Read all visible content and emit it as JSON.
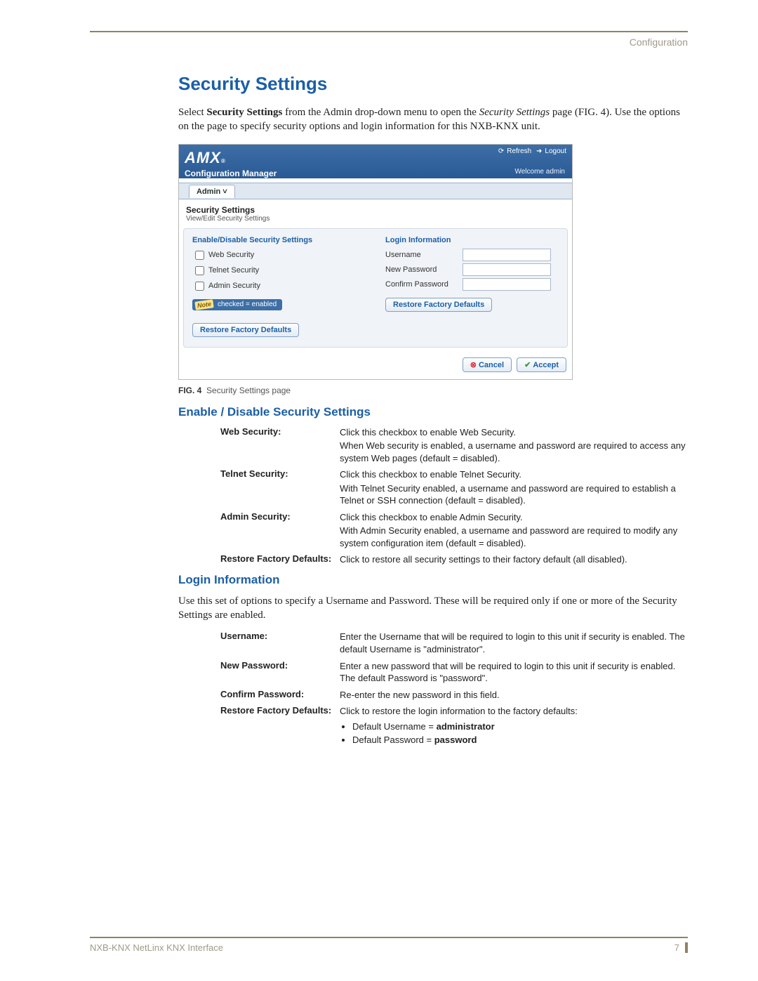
{
  "header": {
    "section_label": "Configuration"
  },
  "title": "Security Settings",
  "intro": {
    "pre": "Select ",
    "bold": "Security Settings",
    "mid": " from the Admin drop-down menu to open the ",
    "ital": "Security Settings",
    "post": " page (FIG. 4). Use the options on the page to specify security options and login information for this NXB-KNX unit."
  },
  "app": {
    "brand": "AMX",
    "subbrand": "Configuration Manager",
    "refresh": "Refresh",
    "logout": "Logout",
    "welcome": "Welcome admin",
    "tab_admin": "Admin ˅",
    "section_title": "Security Settings",
    "section_sub": "View/Edit Security Settings",
    "left_heading": "Enable/Disable Security Settings",
    "cb_web": "Web Security",
    "cb_telnet": "Telnet Security",
    "cb_admin": "Admin Security",
    "note_tag": "Note",
    "note_text": "checked = enabled",
    "btn_restore": "Restore Factory Defaults",
    "right_heading": "Login Information",
    "lbl_username": "Username",
    "lbl_newpw": "New Password",
    "lbl_confpw": "Confirm Password",
    "btn_restore2": "Restore Factory Defaults",
    "btn_cancel": "Cancel",
    "btn_accept": "Accept"
  },
  "fig_caption": {
    "num": "FIG. 4",
    "text": "Security Settings page"
  },
  "subhead1": "Enable / Disable Security Settings",
  "table1": [
    {
      "label": "Web Security:",
      "l1": "Click this checkbox to enable Web Security.",
      "l2": "When Web security is enabled, a username and password are required to access any system Web pages (default = disabled)."
    },
    {
      "label": "Telnet Security:",
      "l1": "Click this checkbox to enable Telnet Security.",
      "l2": "With Telnet Security enabled, a username and password are required to establish a Telnet or SSH connection (default = disabled)."
    },
    {
      "label": "Admin Security:",
      "l1": "Click this checkbox to enable Admin Security.",
      "l2": "With Admin Security enabled, a username and password are required to modify any system configuration item (default = disabled)."
    },
    {
      "label": "Restore Factory Defaults:",
      "l1": "Click to restore all security settings to their factory default (all disabled)."
    }
  ],
  "subhead2": "Login Information",
  "login_intro": "Use this set of options to specify a Username and Password. These will be required only if one or more of the Security Settings are enabled.",
  "table2": {
    "username": {
      "label": "Username:",
      "text": "Enter the Username that will be required to login to this unit if security is enabled. The default Username is \"administrator\"."
    },
    "newpw": {
      "label": "New Password:",
      "text": "Enter a new password that will be required to login to this unit if security is enabled. The default Password is \"password\"."
    },
    "confpw": {
      "label": "Confirm Password:",
      "text": "Re-enter the new password in this field."
    },
    "restore": {
      "label": "Restore Factory Defaults:",
      "text": "Click to restore the login information to the factory defaults:",
      "b1_pre": "Default Username = ",
      "b1_bold": "administrator",
      "b2_pre": "Default Password = ",
      "b2_bold": "password"
    }
  },
  "footer": {
    "doc": "NXB-KNX NetLinx KNX Interface",
    "page": "7"
  }
}
